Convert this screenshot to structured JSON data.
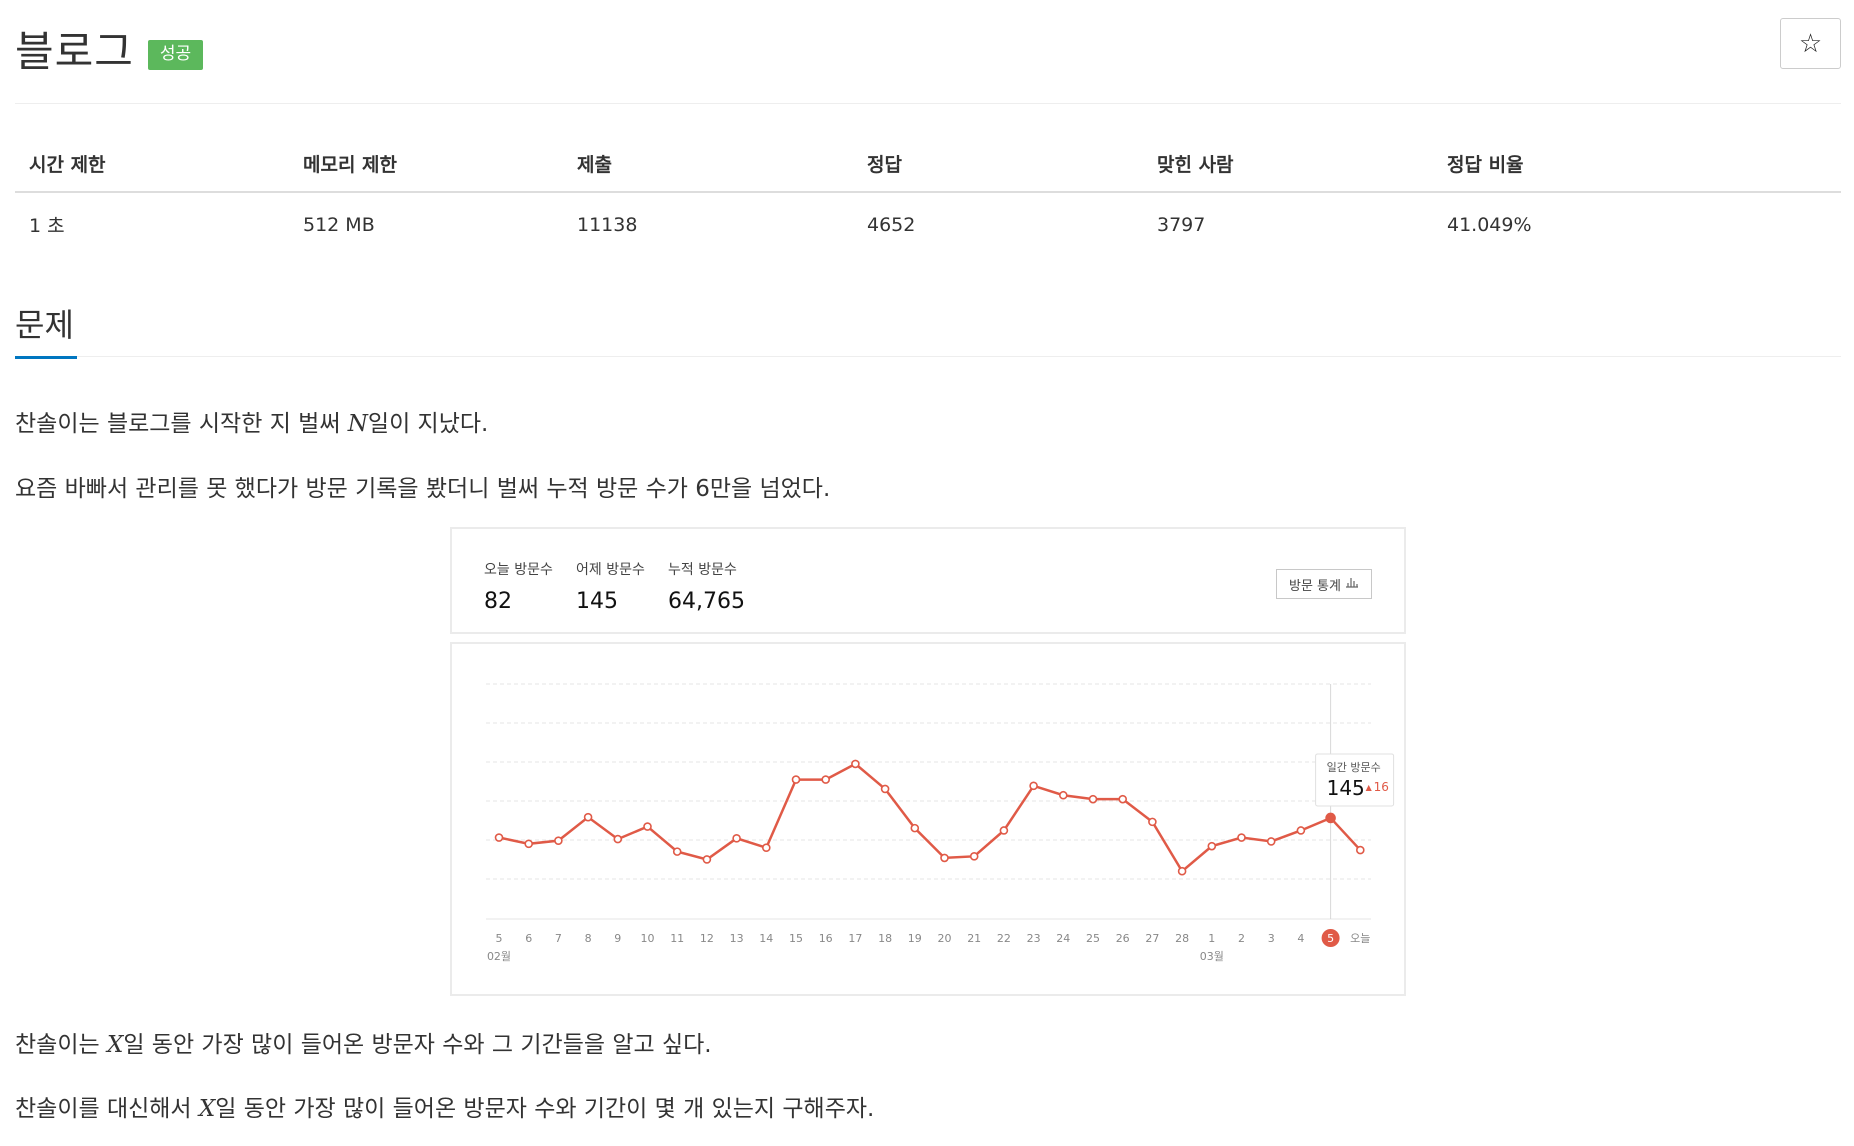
{
  "problem": {
    "title": "블로그",
    "status_badge": "성공",
    "star_label": "☆"
  },
  "info_table": {
    "headers": [
      "시간 제한",
      "메모리 제한",
      "제출",
      "정답",
      "맞힌 사람",
      "정답 비율"
    ],
    "values": [
      "1 초",
      "512 MB",
      "11138",
      "4652",
      "3797",
      "41.049%"
    ]
  },
  "section": {
    "title": "문제"
  },
  "paragraphs": {
    "p1_before": "찬솔이는 블로그를 시작한 지 벌써 ",
    "p1_var": "N",
    "p1_after": "일이 지났다.",
    "p2": "요즘 바빠서 관리를 못 했다가 방문 기록을 봤더니 벌써 누적 방문 수가 6만을 넘었다.",
    "p3_before": "찬솔이는 ",
    "p3_var": "X",
    "p3_after": "일 동안 가장 많이 들어온 방문자 수와 그 기간들을 알고 싶다.",
    "p4_before": "찬솔이를 대신해서 ",
    "p4_var": "X",
    "p4_after": "일 동안 가장 많이 들어온 방문자 수와 기간이 몇 개 있는지 구해주자."
  },
  "widget": {
    "today_label": "오늘 방문수",
    "today_value": "82",
    "yesterday_label": "어제 방문수",
    "yesterday_value": "145",
    "total_label": "누적 방문수",
    "total_value": "64,765",
    "stats_button_label": "방문 통계",
    "stats_icon": "bar-chart-icon",
    "tooltip_label": "일간 방문수",
    "tooltip_value": "145",
    "tooltip_delta": "16",
    "tooltip_arrow": "▲"
  },
  "chart_data": {
    "type": "line",
    "x": [
      "5",
      "6",
      "7",
      "8",
      "9",
      "10",
      "11",
      "12",
      "13",
      "14",
      "15",
      "16",
      "17",
      "18",
      "19",
      "20",
      "21",
      "22",
      "23",
      "24",
      "25",
      "26",
      "27",
      "28",
      "1",
      "2",
      "3",
      "4",
      "5",
      "오늘"
    ],
    "month_labels": [
      {
        "index": 0,
        "label": "02월"
      },
      {
        "index": 24,
        "label": "03월"
      }
    ],
    "highlight_index": 28,
    "ylim": [
      0,
      300
    ],
    "grid": true,
    "line_color": "#e05a47",
    "series": [
      {
        "values": [
          104,
          96,
          100,
          130,
          102,
          118,
          86,
          76,
          103,
          91,
          178,
          178,
          198,
          166,
          116,
          78,
          80,
          113,
          170,
          158,
          153,
          153,
          124,
          61,
          93,
          104,
          99,
          113,
          129,
          88
        ]
      }
    ]
  }
}
